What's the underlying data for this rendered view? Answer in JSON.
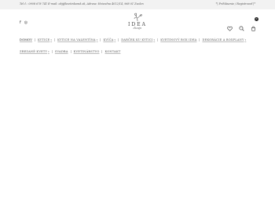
{
  "topbar": {
    "contact": "Tel č.: 0908 678 741 E-mail: obj@kvetinkarak.sk, Adresa: Hviezdna 4012/14, 968 01 Zvolen",
    "login": "Prihlásenie",
    "register": "Registrovať"
  },
  "social": {
    "facebook": "f",
    "instagram": "◎"
  },
  "logo": {
    "word": "IDEA",
    "sub": "dizajn"
  },
  "header": {
    "cart_count": "0"
  },
  "nav": {
    "row1": [
      {
        "label": "DOMOV",
        "caret": false
      },
      {
        "label": "KYTICE",
        "caret": true
      },
      {
        "label": "KYTICE NA VALENTÍNA",
        "caret": true
      },
      {
        "label": "KVÍČA",
        "caret": true
      },
      {
        "label": "DARČEK KU KYTICI",
        "caret": true
      },
      {
        "label": "KVETINOVÝ BOX IDEA",
        "caret": false
      },
      {
        "label": "DEKORÁCIE A BOXPLANY",
        "caret": true
      }
    ],
    "row2": [
      {
        "label": "ZREZANÉ KVETY",
        "caret": true
      },
      {
        "label": "SVADBA",
        "caret": false
      },
      {
        "label": "KVETINÁRSTVO",
        "caret": false
      },
      {
        "label": "KONTAKT",
        "caret": false
      }
    ]
  }
}
